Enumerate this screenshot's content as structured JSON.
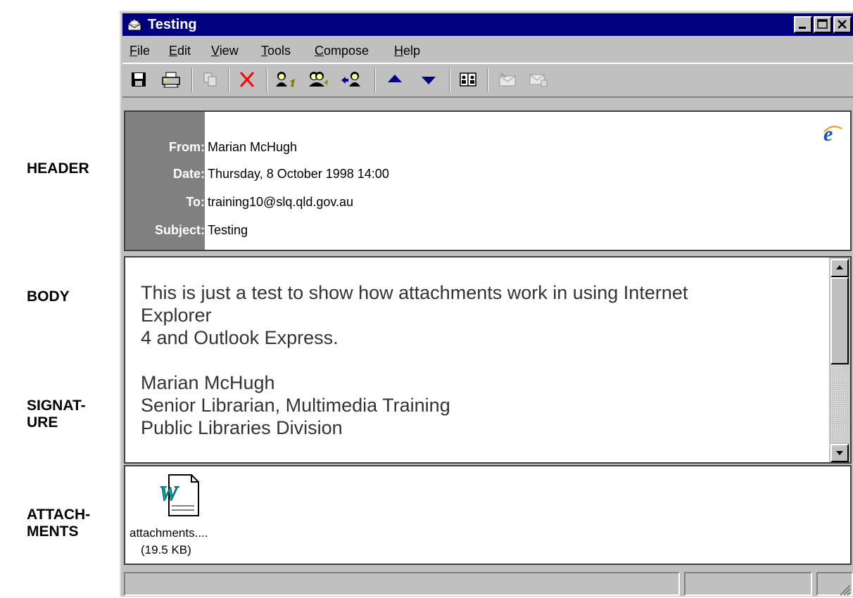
{
  "side_labels": {
    "header": "HEADER",
    "body": "BODY",
    "signature": "SIGNAT-\nURE",
    "attachments": "ATTACH-\nMENTS"
  },
  "window": {
    "title": "Testing",
    "title_icon": "envelope-icon",
    "controls": [
      "minimize-icon",
      "maximize-icon",
      "close-icon"
    ]
  },
  "menu": [
    {
      "label": "File",
      "accel": "F",
      "rest": "ile"
    },
    {
      "label": "Edit",
      "accel": "E",
      "rest": "dit"
    },
    {
      "label": "View",
      "accel": "V",
      "rest": "iew"
    },
    {
      "label": "Tools",
      "accel": "T",
      "rest": "ools"
    },
    {
      "label": "Compose",
      "accel": "C",
      "rest": "ompose"
    },
    {
      "label": "Help",
      "accel": "H",
      "rest": "elp"
    }
  ],
  "toolbar": {
    "icons": [
      "save-icon",
      "print-icon",
      "copy-icon",
      "delete-icon",
      "reply-icon",
      "reply-all-icon",
      "forward-icon",
      "previous-icon",
      "next-icon",
      "address-book-icon",
      "new-message-icon",
      "send-receive-icon"
    ],
    "disabled": [
      "copy-icon",
      "new-message-icon",
      "send-receive-icon"
    ],
    "accent_delete": "#ff0000"
  },
  "header": {
    "brand_icon": "internet-explorer-icon",
    "fields": [
      {
        "label": "From:",
        "value": "Marian McHugh"
      },
      {
        "label": "Date:",
        "value": "Thursday, 8 October 1998 14:00"
      },
      {
        "label": "To:",
        "value": "training10@slq.qld.gov.au"
      },
      {
        "label": "Subject:",
        "value": "Testing"
      }
    ]
  },
  "body": {
    "text": "This is just a test to show how attachments work in using Internet\nExplorer\n4 and Outlook Express.\n\nMarian McHugh\nSenior Librarian, Multimedia Training\nPublic Libraries Division"
  },
  "attachments": [
    {
      "name": "attachments....",
      "size": "(19.5 KB)",
      "icon": "word-document-icon"
    }
  ],
  "colors": {
    "titlebar": "#000080",
    "chrome": "#c0c0c0",
    "header_label_bg": "#808080"
  }
}
